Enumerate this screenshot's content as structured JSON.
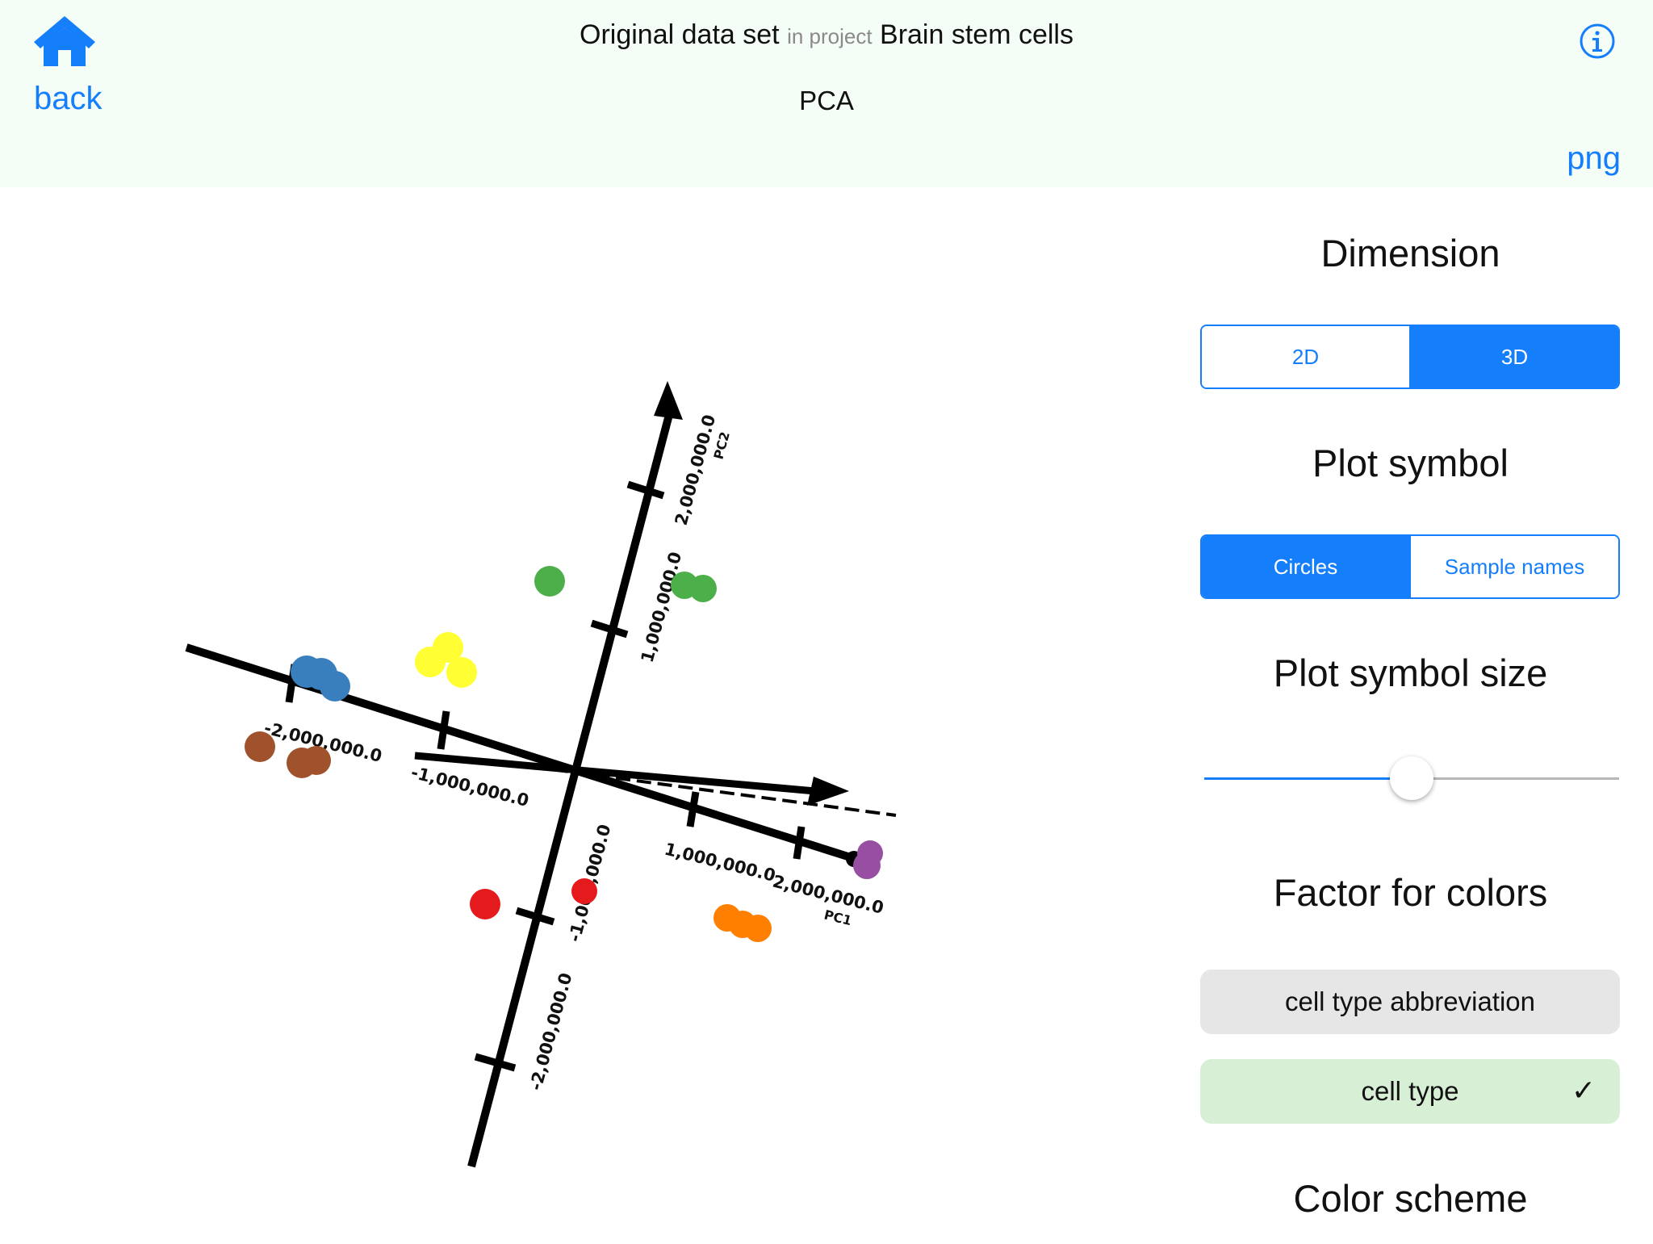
{
  "header": {
    "back_label": "back",
    "dataset_name": "Original data set",
    "in_project": "in project",
    "project_name": "Brain stem cells",
    "subtitle": "PCA",
    "png_label": "png",
    "accent_color": "#147efb"
  },
  "plot": {
    "axis_pc1": "PC1",
    "axis_pc2": "PC2",
    "ticks": {
      "neg2": "-2,000,000.0",
      "neg1": "-1,000,000.0",
      "pos1": "1,000,000.0",
      "pos2": "2,000,000.0"
    },
    "cluster_colors": {
      "blue": "#3a7fbd",
      "brown": "#a0522d",
      "yellow": "#ffff33",
      "green": "#4daf4a",
      "red": "#e41a1c",
      "orange": "#ff7f00",
      "purple": "#984ea3"
    }
  },
  "panel": {
    "dimension_title": "Dimension",
    "dimension_options": [
      "2D",
      "3D"
    ],
    "dimension_selected": "3D",
    "symbol_title": "Plot symbol",
    "symbol_options": [
      "Circles",
      "Sample names"
    ],
    "symbol_selected": "Circles",
    "size_title": "Plot symbol size",
    "size_value": 0.5,
    "factor_title": "Factor for colors",
    "factor_options": [
      "cell type abbreviation",
      "cell type"
    ],
    "factor_selected": "cell type",
    "checkmark": "✓",
    "scheme_title": "Color scheme"
  }
}
